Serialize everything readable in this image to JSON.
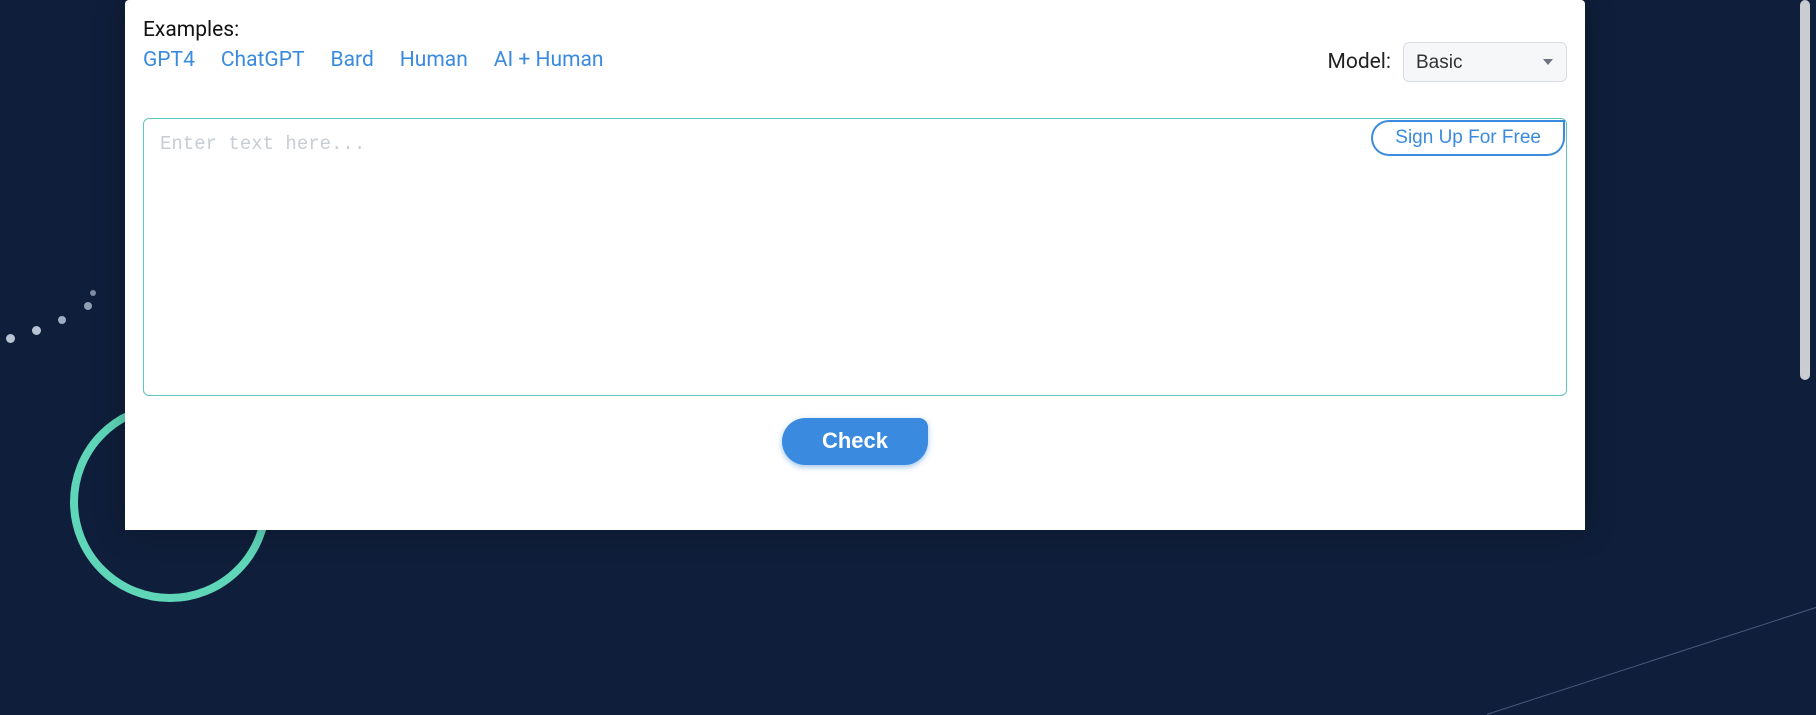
{
  "colors": {
    "accent_blue": "#3a8be0",
    "teal_border": "#5fc5c0",
    "dark_bg": "#0f1e3a",
    "green_ring": "#5fd6b8"
  },
  "examples": {
    "label": "Examples:",
    "items": [
      "GPT4",
      "ChatGPT",
      "Bard",
      "Human",
      "AI + Human"
    ]
  },
  "model": {
    "label": "Model:",
    "selected": "Basic"
  },
  "textarea": {
    "placeholder": "Enter text here...",
    "value": ""
  },
  "buttons": {
    "signup": "Sign Up For Free",
    "check": "Check"
  }
}
